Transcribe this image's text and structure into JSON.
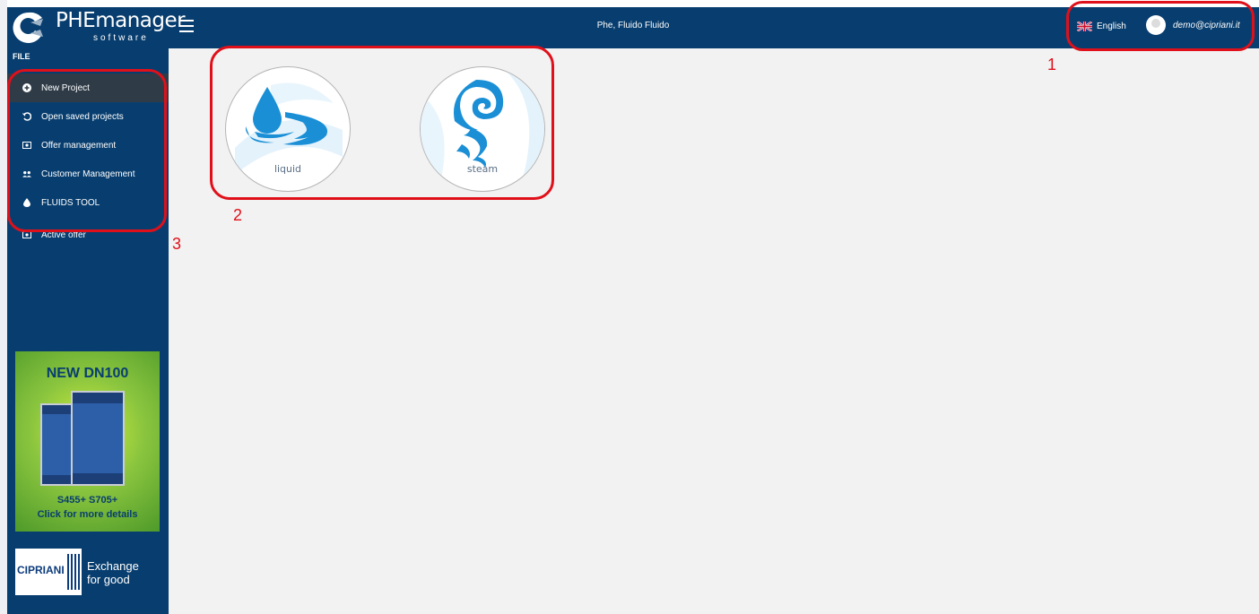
{
  "app": {
    "logo_text": "PHEmanager",
    "logo_sub": "software",
    "project_title": "Phe, Fluido Fluido"
  },
  "header": {
    "language": "English",
    "user_email": "demo@cipriani.it"
  },
  "sidebar": {
    "section": "FILE",
    "items": [
      {
        "label": "New Project",
        "icon": "plus-circle-icon"
      },
      {
        "label": "Open saved projects",
        "icon": "history-icon"
      },
      {
        "label": "Offer management",
        "icon": "money-icon"
      },
      {
        "label": "Customer Management",
        "icon": "users-icon"
      },
      {
        "label": "FLUIDS TOOL",
        "icon": "drop-icon"
      },
      {
        "label": "Active offer",
        "icon": "money-icon"
      }
    ],
    "banner": {
      "title": "NEW DN100",
      "models": "S455+   S705+",
      "link": "Click for more details"
    },
    "brand": {
      "name": "CIPRIANI",
      "slogan_line1": "Exchange",
      "slogan_line2": "for good"
    }
  },
  "main": {
    "cards": [
      {
        "label": "liquid",
        "icon": "water-drop-icon"
      },
      {
        "label": "steam",
        "icon": "steam-swirl-icon"
      }
    ]
  },
  "annotations": [
    "1",
    "2",
    "3"
  ],
  "colors": {
    "navy": "#083e6f",
    "active_item": "#2f3c48",
    "drop_blue": "#1a8fd6",
    "annotation_red": "#e0101a",
    "main_bg": "#f2f2f2"
  }
}
